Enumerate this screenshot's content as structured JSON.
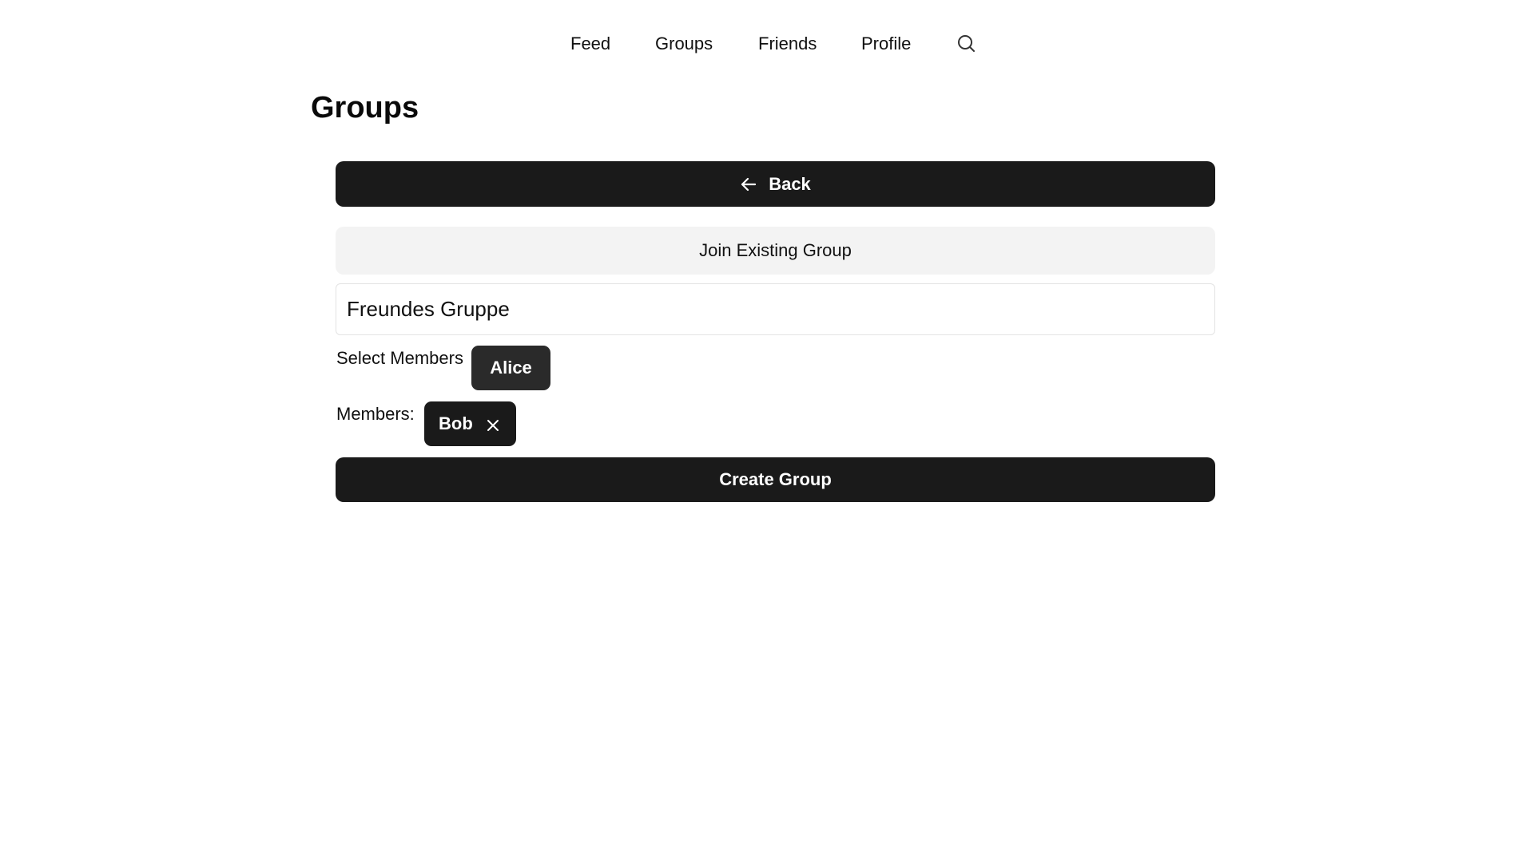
{
  "nav": {
    "items": [
      {
        "label": "Feed"
      },
      {
        "label": "Groups"
      },
      {
        "label": "Friends"
      },
      {
        "label": "Profile"
      }
    ],
    "search_icon": "search-icon"
  },
  "page": {
    "title": "Groups"
  },
  "back_button": {
    "label": "Back",
    "icon": "arrow-left-icon"
  },
  "join_button": {
    "label": "Join Existing Group"
  },
  "group_name_input": {
    "value": "Freundes Gruppe"
  },
  "select_members": {
    "label": "Select Members",
    "options": [
      {
        "name": "Alice"
      }
    ]
  },
  "members": {
    "label": "Members:",
    "selected": [
      {
        "name": "Bob",
        "remove_icon": "close-icon"
      }
    ]
  },
  "create_button": {
    "label": "Create Group"
  },
  "colors": {
    "primary_dark": "#1a1a1a",
    "chip_dark": "#2a2a2a",
    "secondary_bg": "#f3f3f3",
    "input_border": "#e3e3e3"
  }
}
